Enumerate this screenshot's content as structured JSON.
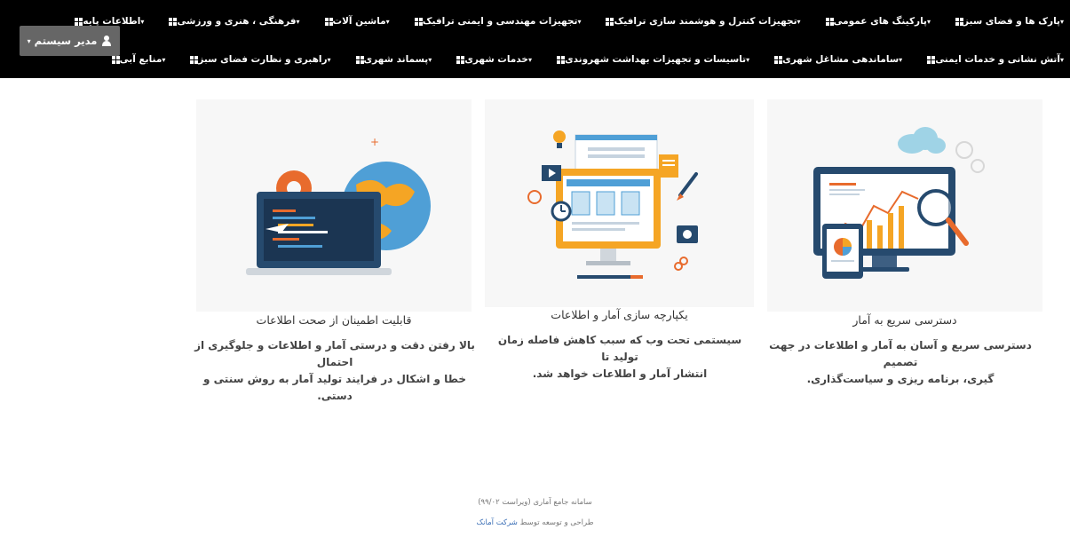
{
  "navbar": {
    "row1": [
      {
        "label": "اطلاعات پایه",
        "icon": "grid-icon"
      },
      {
        "label": "فرهنگی ، هنری و ورزشی",
        "icon": "grid-icon"
      },
      {
        "label": "ماشین آلات",
        "icon": "grid-icon"
      },
      {
        "label": "تجهیزات مهندسی و ایمنی ترافیک",
        "icon": "grid-icon"
      },
      {
        "label": "تجهیزات کنترل و هوشمند سازی ترافیک",
        "icon": "grid-icon"
      },
      {
        "label": "پارکینگ های عمومی",
        "icon": "grid-icon"
      },
      {
        "label": "پارک ها و فضای سبز",
        "icon": "grid-icon"
      }
    ],
    "row2": [
      {
        "label": "منابع آبی",
        "icon": "grid-icon"
      },
      {
        "label": "راهبری و نظارت فضای سبز",
        "icon": "grid-icon"
      },
      {
        "label": "پسماند شهری",
        "icon": "grid-icon"
      },
      {
        "label": "خدمات شهری",
        "icon": "grid-icon"
      },
      {
        "label": "تاسیسات و تجهیزات بهداشت شهروندی",
        "icon": "grid-icon"
      },
      {
        "label": "ساماندهی مشاغل شهری",
        "icon": "grid-icon"
      },
      {
        "label": "آتش نشانی و خدمات ایمنی",
        "icon": "grid-icon"
      }
    ],
    "user_menu": {
      "label": "مدیر سیستم",
      "icon": "user-icon"
    }
  },
  "features": [
    {
      "title": "دسترسی سریع به آمار",
      "desc_line1": "دسترسی سریع و آسان به آمار و اطلاعات در جهت تصمیم",
      "desc_line2": "گیری، برنامه ریزی و سیاست‌گذاری."
    },
    {
      "title": "یکپارچه سازی آمار و اطلاعات",
      "desc_line1": "سیستمی تحت وب که سبب کاهش فاصله زمان تولید تا",
      "desc_line2": "انتشار آمار و اطلاعات خواهد شد."
    },
    {
      "title": "قابلیت اطمینان از صحت اطلاعات",
      "desc_line1": "بالا رفتن دقت و درستی آمار و اطلاعات و جلوگیری از احتمال",
      "desc_line2": "خطا و اشکال در فرایند تولید آمار به روش سنتی و دستی."
    }
  ],
  "footer": {
    "version": "سامانه جامع آماری (ویراست ۹۹/۰۲)",
    "credit_prefix": "طراحی و توسعه توسط",
    "company": "شرکت آمانک"
  },
  "colors": {
    "navbar_bg": "#000000",
    "user_button_bg": "#666666",
    "link": "#3b6fb6",
    "card_bg": "#f7f7f7"
  }
}
